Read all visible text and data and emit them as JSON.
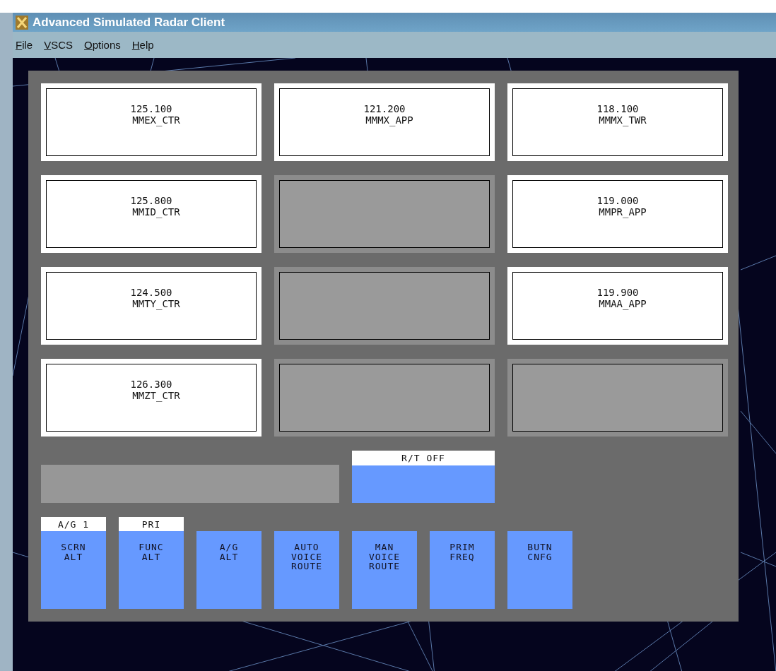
{
  "window": {
    "title": "Advanced Simulated Radar Client"
  },
  "menu": [
    {
      "label": "File"
    },
    {
      "label": "VSCS"
    },
    {
      "label": "Options"
    },
    {
      "label": "Help"
    }
  ],
  "frequency_keys": [
    {
      "kind": "assigned",
      "frequency": "125.100",
      "callsign": "MMEX_CTR"
    },
    {
      "kind": "assigned",
      "frequency": "121.200",
      "callsign": "MMMX_APP"
    },
    {
      "kind": "assigned",
      "frequency": "118.100",
      "callsign": "MMMX_TWR"
    },
    {
      "kind": "assigned",
      "frequency": "125.800",
      "callsign": "MMID_CTR"
    },
    {
      "kind": "empty"
    },
    {
      "kind": "assigned",
      "frequency": "119.000",
      "callsign": "MMPR_APP"
    },
    {
      "kind": "assigned",
      "frequency": "124.500",
      "callsign": "MMTY_CTR"
    },
    {
      "kind": "empty"
    },
    {
      "kind": "assigned",
      "frequency": "119.900",
      "callsign": "MMAA_APP"
    },
    {
      "kind": "assigned",
      "frequency": "126.300",
      "callsign": "MMZT_CTR"
    },
    {
      "kind": "empty"
    },
    {
      "kind": "empty"
    }
  ],
  "rt_key": {
    "header": "R/T OFF"
  },
  "function_keys": [
    {
      "header": "A/G 1",
      "lines": [
        "SCRN",
        "ALT"
      ]
    },
    {
      "header": "PRI",
      "lines": [
        "FUNC",
        "ALT"
      ]
    },
    {
      "lines": [
        "A/G",
        "ALT"
      ]
    },
    {
      "lines": [
        "AUTO",
        "VOICE",
        "ROUTE"
      ]
    },
    {
      "lines": [
        "MAN",
        "VOICE",
        "ROUTE"
      ]
    },
    {
      "lines": [
        "PRIM",
        "FREQ"
      ]
    },
    {
      "lines": [
        "BUTN",
        "CNFG"
      ]
    }
  ]
}
